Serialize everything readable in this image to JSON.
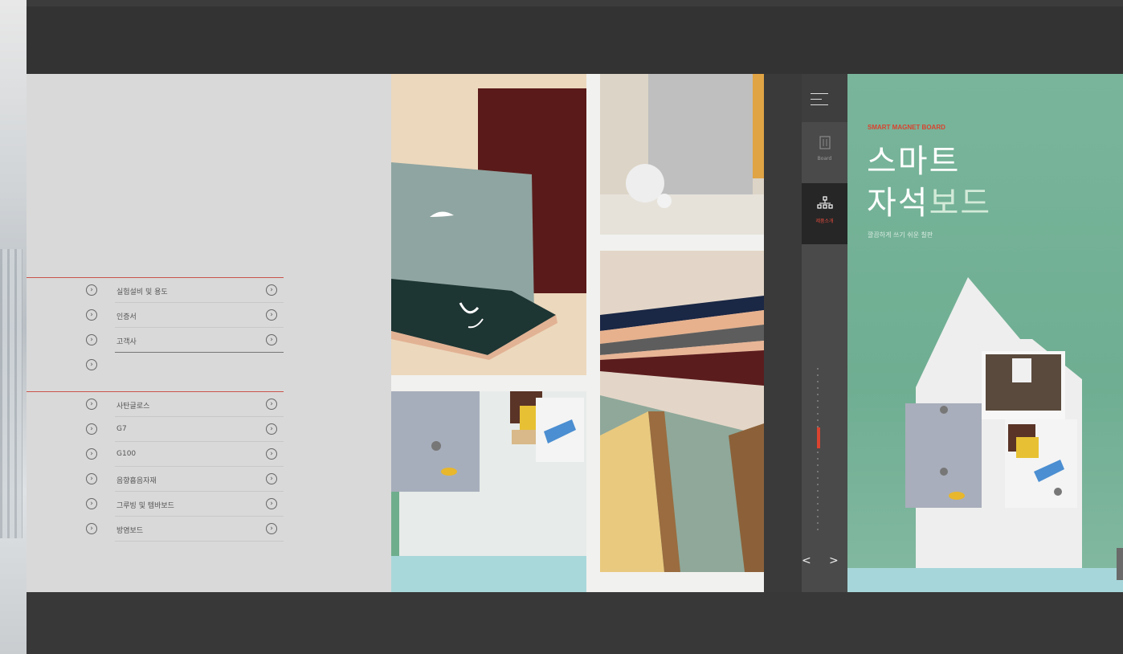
{
  "menu_group_1": [
    {
      "label": "실험설비 및 용도"
    },
    {
      "label": "인증서"
    },
    {
      "label": "고객사"
    },
    {
      "label": ""
    }
  ],
  "menu_group_2": [
    {
      "label": "사탄글로스"
    },
    {
      "label": "G7"
    },
    {
      "label": "G100"
    },
    {
      "label": "음향흡음자재"
    },
    {
      "label": "그루빙 및 템바보드"
    },
    {
      "label": "방염보드"
    }
  ],
  "sidenav": {
    "tab1_label": "Board",
    "tab2_label": "제품소개",
    "prev": "<",
    "next": ">"
  },
  "cover": {
    "eyebrow": "SMART MAGNET BOARD",
    "title_line1": "스마트",
    "title_line2a": "자석",
    "title_line2b": "보드",
    "subtitle": "깔끔하게 쓰기 쉬운 칠판"
  },
  "colors": {
    "accent": "#d9432f",
    "dark_bg": "#3c3c3c",
    "cover_green": "#79b59b"
  }
}
